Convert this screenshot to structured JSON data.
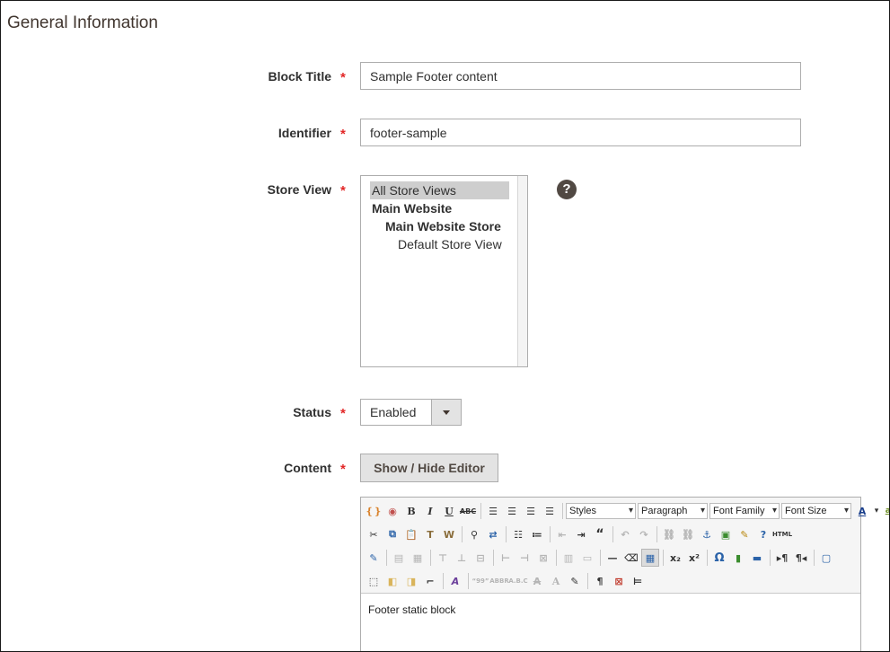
{
  "section": {
    "title": "General Information"
  },
  "fields": {
    "block_title": {
      "label": "Block Title",
      "value": "Sample Footer content"
    },
    "identifier": {
      "label": "Identifier",
      "value": "footer-sample"
    },
    "store_view": {
      "label": "Store View",
      "options": [
        "All Store Views",
        "Main Website",
        "Main Website Store",
        "Default Store View"
      ],
      "selected": "All Store Views",
      "help": "?"
    },
    "status": {
      "label": "Status",
      "value": "Enabled"
    },
    "content": {
      "label": "Content",
      "toggle_button": "Show / Hide Editor",
      "editor_text": "Footer static block",
      "dropdowns": [
        "Styles",
        "Paragraph",
        "Font Family",
        "Font Size"
      ]
    }
  },
  "required_mark": "*",
  "colors": {
    "required": "#e22626",
    "button_bg": "#e3e3e3",
    "help_icon": "#514943"
  }
}
